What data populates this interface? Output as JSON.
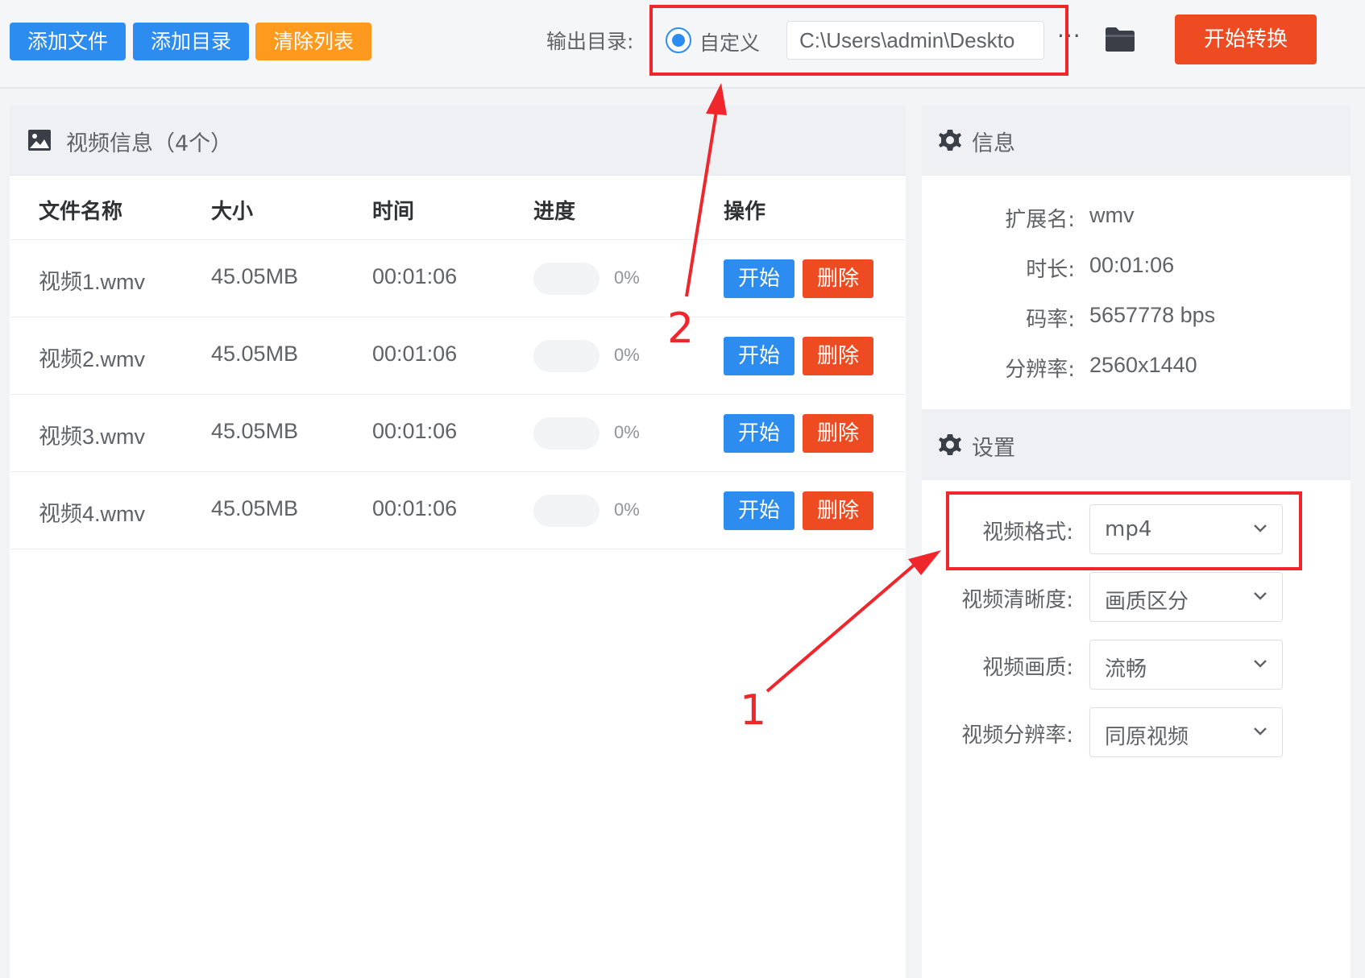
{
  "toolbar": {
    "add_file": "添加文件",
    "add_dir": "添加目录",
    "clear_list": "清除列表",
    "output_label": "输出目录:",
    "radio_label": "自定义",
    "path_value": "C:\\Users\\admin\\Deskto",
    "more": "···",
    "start_convert": "开始转换"
  },
  "left": {
    "title": "视频信息（4个）",
    "columns": [
      "文件名称",
      "大小",
      "时间",
      "进度",
      "操作"
    ],
    "rows": [
      {
        "name": "视频1.wmv",
        "size": "45.05MB",
        "time": "00:01:06",
        "progress": 0,
        "progress_text": "0%",
        "start": "开始",
        "delete": "删除"
      },
      {
        "name": "视频2.wmv",
        "size": "45.05MB",
        "time": "00:01:06",
        "progress": 0,
        "progress_text": "0%",
        "start": "开始",
        "delete": "删除"
      },
      {
        "name": "视频3.wmv",
        "size": "45.05MB",
        "time": "00:01:06",
        "progress": 0,
        "progress_text": "0%",
        "start": "开始",
        "delete": "删除"
      },
      {
        "name": "视频4.wmv",
        "size": "45.05MB",
        "time": "00:01:06",
        "progress": 0,
        "progress_text": "0%",
        "start": "开始",
        "delete": "删除"
      }
    ]
  },
  "info": {
    "title": "信息",
    "items": [
      {
        "key": "扩展名:",
        "value": "wmv"
      },
      {
        "key": "时长:",
        "value": "00:01:06"
      },
      {
        "key": "码率:",
        "value": "5657778 bps"
      },
      {
        "key": "分辨率:",
        "value": "2560x1440"
      }
    ]
  },
  "settings": {
    "title": "设置",
    "items": [
      {
        "key": "视频格式:",
        "value": "mp4"
      },
      {
        "key": "视频清晰度:",
        "value": "画质区分"
      },
      {
        "key": "视频画质:",
        "value": "流畅"
      },
      {
        "key": "视频分辨率:",
        "value": "同原视频"
      }
    ]
  },
  "annotations": {
    "one": "1",
    "two": "2"
  },
  "colors": {
    "blue": "#2d8cf0",
    "orange": "#ff9a1f",
    "red": "#ef4b22",
    "annotation": "#f0262d"
  },
  "icons": [
    "radio-selected-icon",
    "folder-icon",
    "image-icon",
    "gear-icon",
    "chevron-down-icon"
  ]
}
